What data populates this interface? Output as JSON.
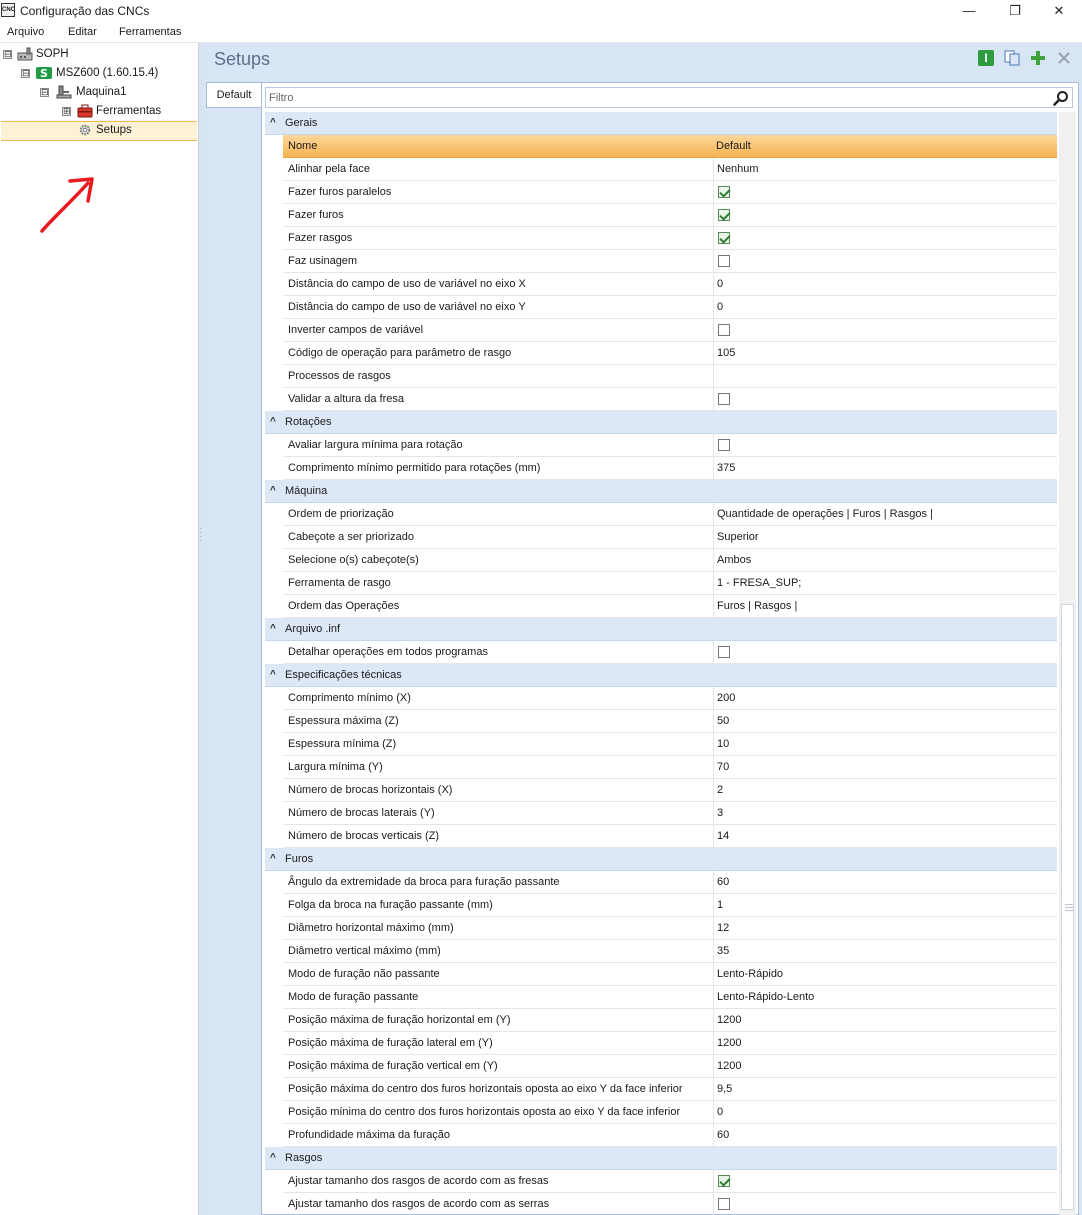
{
  "window": {
    "title": "Configuração das CNCs",
    "app_icon_text": "CNC",
    "minimize": "—",
    "restore": "❐",
    "close": "✕"
  },
  "menu": [
    "Arquivo",
    "Editar",
    "Ferramentas"
  ],
  "tree": {
    "root": "SOPH",
    "machine": "MSZ600 (1.60.15.4)",
    "maquina": "Maquina1",
    "ferramentas": "Ferramentas",
    "setups": "Setups",
    "expanded": "⊟",
    "collapsed": "⊞"
  },
  "main": {
    "title": "Setups",
    "tab": "Default",
    "filter_placeholder": "Filtro"
  },
  "colors": {
    "accent_orange": "#f6b352",
    "group_bg": "#dde8f6",
    "panel_bg": "#d8e5f5",
    "arrow": "#e8191f"
  },
  "grid": {
    "col_name": "Nome",
    "col_value": "Default",
    "groups": [
      {
        "title": "Gerais",
        "header": true,
        "rows": [
          {
            "name": "Alinhar pela face",
            "value": "Nenhum"
          },
          {
            "name": "Fazer furos paralelos",
            "check": true
          },
          {
            "name": "Fazer furos",
            "check": true
          },
          {
            "name": "Fazer rasgos",
            "check": true
          },
          {
            "name": "Faz usinagem",
            "check": false
          },
          {
            "name": "Distância do campo de uso de variável no eixo X",
            "value": "0"
          },
          {
            "name": "Distância do campo de uso de variável no eixo Y",
            "value": "0"
          },
          {
            "name": "Inverter campos de variável",
            "check": false
          },
          {
            "name": "Código de operação para parâmetro de rasgo",
            "value": "105"
          },
          {
            "name": "Processos de rasgos",
            "value": ""
          },
          {
            "name": "Validar a altura da fresa",
            "check": false
          }
        ]
      },
      {
        "title": "Rotações",
        "rows": [
          {
            "name": "Avaliar largura mínima para rotação",
            "check": false
          },
          {
            "name": "Comprimento mínimo permitido para rotações (mm)",
            "value": "375"
          }
        ]
      },
      {
        "title": "Máquina",
        "rows": [
          {
            "name": "Ordem de priorização",
            "value": "Quantidade de operações | Furos | Rasgos |"
          },
          {
            "name": "Cabeçote a ser priorizado",
            "value": "Superior"
          },
          {
            "name": "Selecione o(s) cabeçote(s)",
            "value": "Ambos"
          },
          {
            "name": "Ferramenta de rasgo",
            "value": "1 - FRESA_SUP;"
          },
          {
            "name": "Ordem das Operações",
            "value": "Furos | Rasgos |"
          }
        ]
      },
      {
        "title": "Arquivo .inf",
        "rows": [
          {
            "name": "Detalhar operações em todos programas",
            "check": false
          }
        ]
      },
      {
        "title": "Especificações técnicas",
        "rows": [
          {
            "name": "Comprimento mínimo (X)",
            "value": "200"
          },
          {
            "name": "Espessura máxima (Z)",
            "value": "50"
          },
          {
            "name": "Espessura mínima (Z)",
            "value": "10"
          },
          {
            "name": "Largura mínima (Y)",
            "value": "70"
          },
          {
            "name": "Número de brocas horizontais (X)",
            "value": "2"
          },
          {
            "name": "Número de brocas laterais (Y)",
            "value": "3"
          },
          {
            "name": "Número de brocas verticais (Z)",
            "value": "14"
          }
        ]
      },
      {
        "title": "Furos",
        "rows": [
          {
            "name": "Ângulo da extremidade da broca para furação passante",
            "value": "60"
          },
          {
            "name": "Folga da broca na furação passante (mm)",
            "value": "1"
          },
          {
            "name": "Diâmetro horizontal máximo (mm)",
            "value": "12"
          },
          {
            "name": "Diâmetro vertical máximo (mm)",
            "value": "35"
          },
          {
            "name": "Modo de furação não passante",
            "value": "Lento-Rápido"
          },
          {
            "name": "Modo de furação passante",
            "value": "Lento-Rápido-Lento"
          },
          {
            "name": "Posição máxima de furação horizontal em (Y)",
            "value": "1200"
          },
          {
            "name": "Posição máxima de furação lateral em (Y)",
            "value": "1200"
          },
          {
            "name": "Posição máxima de furação vertical em (Y)",
            "value": "1200"
          },
          {
            "name": "Posição máxima do centro dos furos horizontais oposta ao eixo Y da face inferior",
            "value": "9,5"
          },
          {
            "name": "Posição mínima do centro dos furos horizontais oposta ao eixo Y da face inferior",
            "value": "0"
          },
          {
            "name": "Profundidade máxima da furação",
            "value": "60"
          }
        ]
      },
      {
        "title": "Rasgos",
        "rows": [
          {
            "name": "Ajustar tamanho dos rasgos de acordo com as fresas",
            "check": true
          },
          {
            "name": "Ajustar tamanho dos rasgos de acordo com as serras",
            "check": false
          }
        ]
      }
    ]
  }
}
